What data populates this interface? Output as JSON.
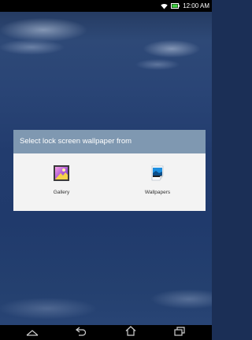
{
  "status_bar": {
    "time": "12:00 AM",
    "icons": [
      "wifi-icon",
      "battery-icon"
    ]
  },
  "dialog": {
    "title": "Select lock screen wallpaper from",
    "options": [
      {
        "label": "Gallery",
        "icon": "gallery-icon"
      },
      {
        "label": "Wallpapers",
        "icon": "wallpapers-icon"
      }
    ]
  },
  "nav_bar": {
    "buttons": [
      "collapse-icon",
      "back-icon",
      "home-icon",
      "recent-apps-icon"
    ]
  },
  "colors": {
    "dialog_title_bg": "#7f98b1",
    "dialog_bg": "#f3f3f3",
    "bars": "#000000"
  }
}
